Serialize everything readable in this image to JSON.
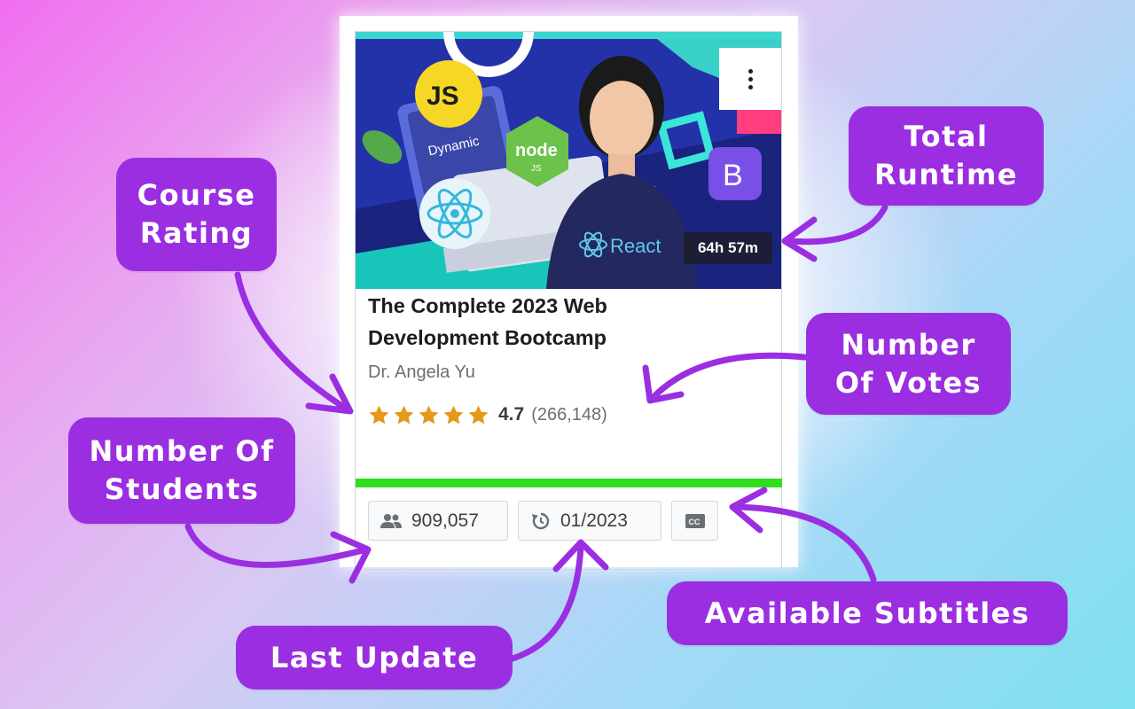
{
  "course": {
    "thumbnail_text": {
      "js": "JS",
      "dynamic": "Dynamic",
      "node": "node",
      "node_sub": "JS",
      "bootstrap": "B",
      "react": "React"
    },
    "runtime": "64h 57m",
    "title_line1": "The Complete 2023 Web",
    "title_line2": "Development Bootcamp",
    "author": "Dr. Angela Yu",
    "rating": "4.7",
    "rating_value": 4.7,
    "stars_filled": 5,
    "votes": "(266,148)",
    "progress_fraction": 1.0,
    "students": "909,057",
    "last_update": "01/2023",
    "icons": {
      "menu": "kebab-menu-icon",
      "students": "people-icon",
      "update": "refresh-clock-icon",
      "subtitles": "closed-captions-icon",
      "star": "star-icon"
    }
  },
  "callouts": {
    "rating": "Course\nRating",
    "runtime": "Total\nRuntime",
    "votes": "Number\nOf Votes",
    "students": "Number Of\nStudents",
    "subtitles": "Available Subtitles",
    "update": "Last Update"
  },
  "colors": {
    "callout_bg": "#9a2ee0",
    "star": "#e59819",
    "progress": "#2fdf1c",
    "title": "#1c1d1f"
  }
}
